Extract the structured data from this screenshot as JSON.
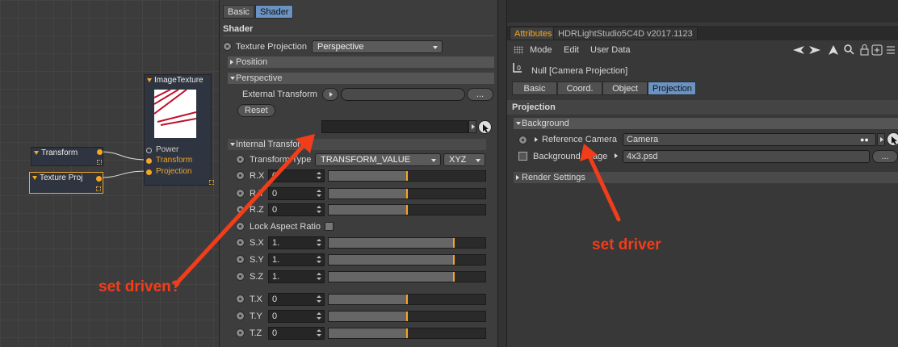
{
  "nodes": {
    "image_texture": {
      "title": "ImageTexture",
      "ports": [
        "Power",
        "Transform",
        "Projection"
      ]
    },
    "transform": {
      "title": "Transform"
    },
    "texture_proj": {
      "title": "Texture Proj"
    }
  },
  "shader": {
    "tabs": [
      "Basic",
      "Shader"
    ],
    "header": "Shader",
    "texture_projection_label": "Texture Projection",
    "texture_projection_value": "Perspective",
    "position_section": "Position",
    "perspective_section": "Perspective",
    "external_transform_label": "External Transform",
    "external_transform_btn": "...",
    "reset_label": "Reset",
    "internal_transform_section": "Internal Transform",
    "transform_type_label": "Transform Type",
    "transform_type_value": "TRANSFORM_VALUE",
    "transform_order_value": "XYZ",
    "lock_aspect_label": "Lock Aspect Ratio",
    "rows": [
      {
        "label": "R.X",
        "value": "0",
        "level": 0.5
      },
      {
        "label": "R.Y",
        "value": "0",
        "level": 0.5
      },
      {
        "label": "R.Z",
        "value": "0",
        "level": 0.5
      },
      {
        "label": "S.X",
        "value": "1.",
        "level": 0.8
      },
      {
        "label": "S.Y",
        "value": "1.",
        "level": 0.8
      },
      {
        "label": "S.Z",
        "value": "1.",
        "level": 0.8
      },
      {
        "label": "T.X",
        "value": "0",
        "level": 0.5
      },
      {
        "label": "T.Y",
        "value": "0",
        "level": 0.5
      },
      {
        "label": "T.Z",
        "value": "0",
        "level": 0.5
      }
    ]
  },
  "attributes": {
    "tabs": [
      "Attributes",
      "HDRLightStudio5C4D v2017.1123"
    ],
    "menu": [
      "Mode",
      "Edit",
      "User Data"
    ],
    "object_title": "Null [Camera Projection]",
    "subtabs": [
      "Basic",
      "Coord.",
      "Object",
      "Projection"
    ],
    "section": "Projection",
    "background_section": "Background",
    "reference_camera_label": "Reference Camera",
    "reference_camera_value": "Camera",
    "background_image_label": "Background Image",
    "background_image_value": "4x3.psd",
    "browse_btn": "...",
    "render_settings_section": "Render Settings"
  },
  "annotations": {
    "set_driven": "set driven?",
    "set_driver": "set driver",
    "color": "#f23d1a"
  },
  "colors": {
    "accent_tab": "#6a93c4",
    "port": "#f5a623"
  }
}
